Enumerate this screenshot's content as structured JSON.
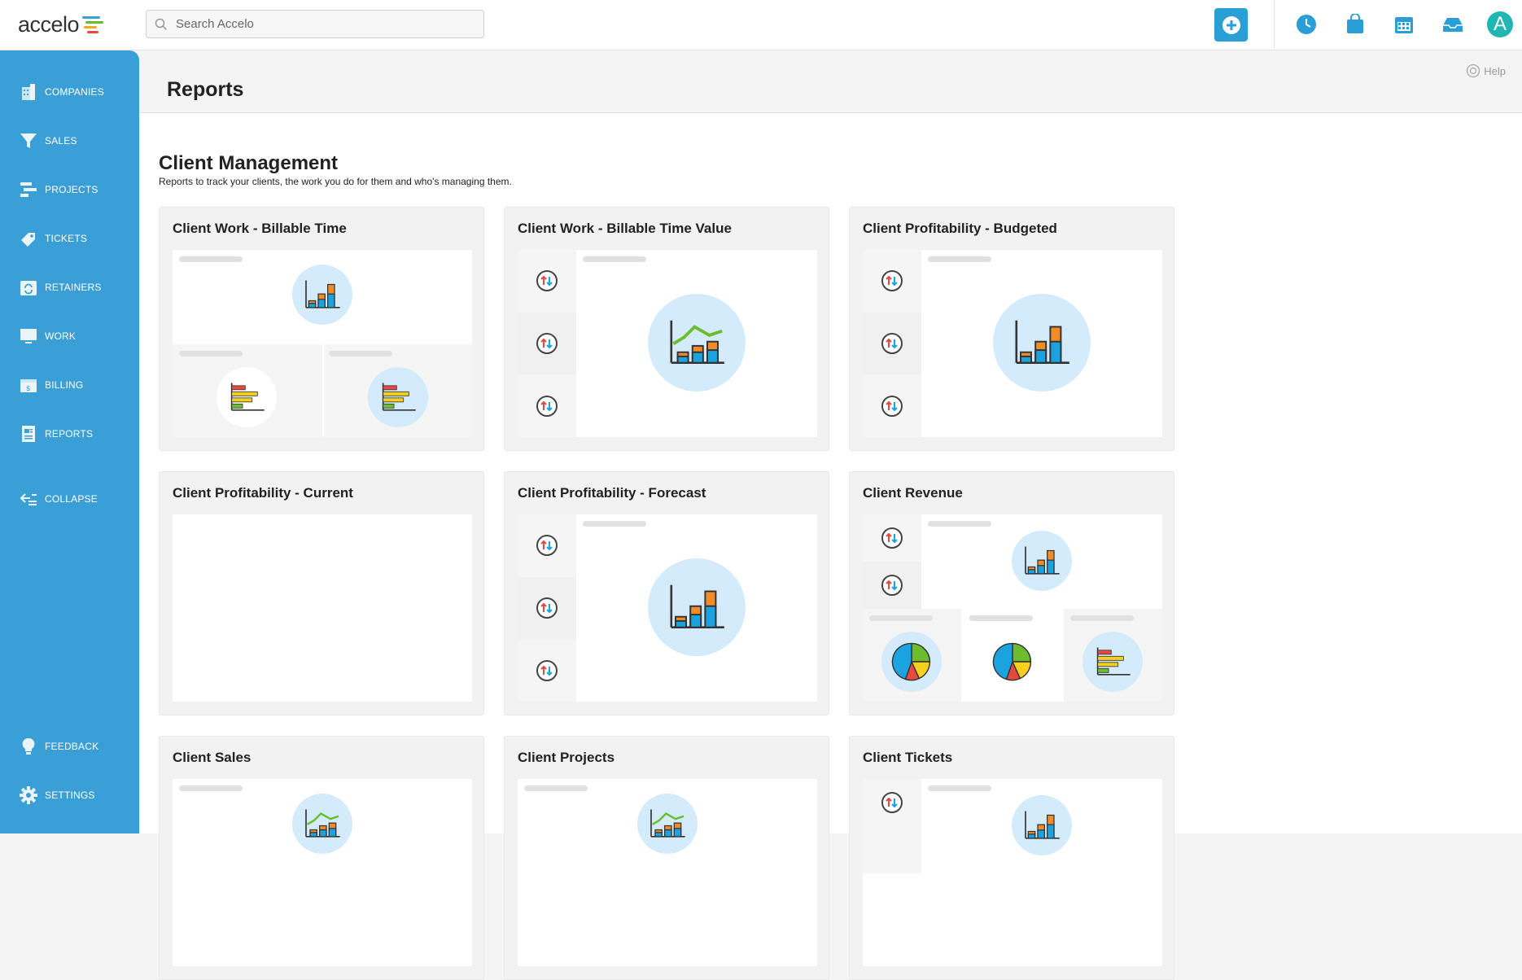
{
  "app": {
    "logo_text": "accelo",
    "search_placeholder": "Search Accelo",
    "avatar_letter": "A",
    "accent_color": "#3a9fd6"
  },
  "sidebar": {
    "items": [
      {
        "label": "COMPANIES",
        "icon": "building-icon"
      },
      {
        "label": "SALES",
        "icon": "funnel-icon"
      },
      {
        "label": "PROJECTS",
        "icon": "gantt-icon"
      },
      {
        "label": "TICKETS",
        "icon": "tag-icon"
      },
      {
        "label": "RETAINERS",
        "icon": "calendar-refresh-icon"
      },
      {
        "label": "WORK",
        "icon": "monitor-icon"
      },
      {
        "label": "BILLING",
        "icon": "invoice-icon"
      },
      {
        "label": "REPORTS",
        "icon": "report-icon"
      }
    ],
    "collapse_label": "COLLAPSE",
    "feedback_label": "FEEDBACK",
    "settings_label": "SETTINGS"
  },
  "header": {
    "title": "Reports",
    "help_label": "Help"
  },
  "section": {
    "title": "Client Management",
    "subtitle": "Reports to track your clients, the work you do for them and who's managing them."
  },
  "cards": [
    {
      "title": "Client Work - Billable Time"
    },
    {
      "title": "Client Work - Billable Time Value"
    },
    {
      "title": "Client Profitability - Budgeted"
    },
    {
      "title": "Client Profitability - Current"
    },
    {
      "title": "Client Profitability - Forecast"
    },
    {
      "title": "Client Revenue"
    },
    {
      "title": "Client Sales"
    },
    {
      "title": "Client Projects"
    },
    {
      "title": "Client Tickets"
    }
  ]
}
